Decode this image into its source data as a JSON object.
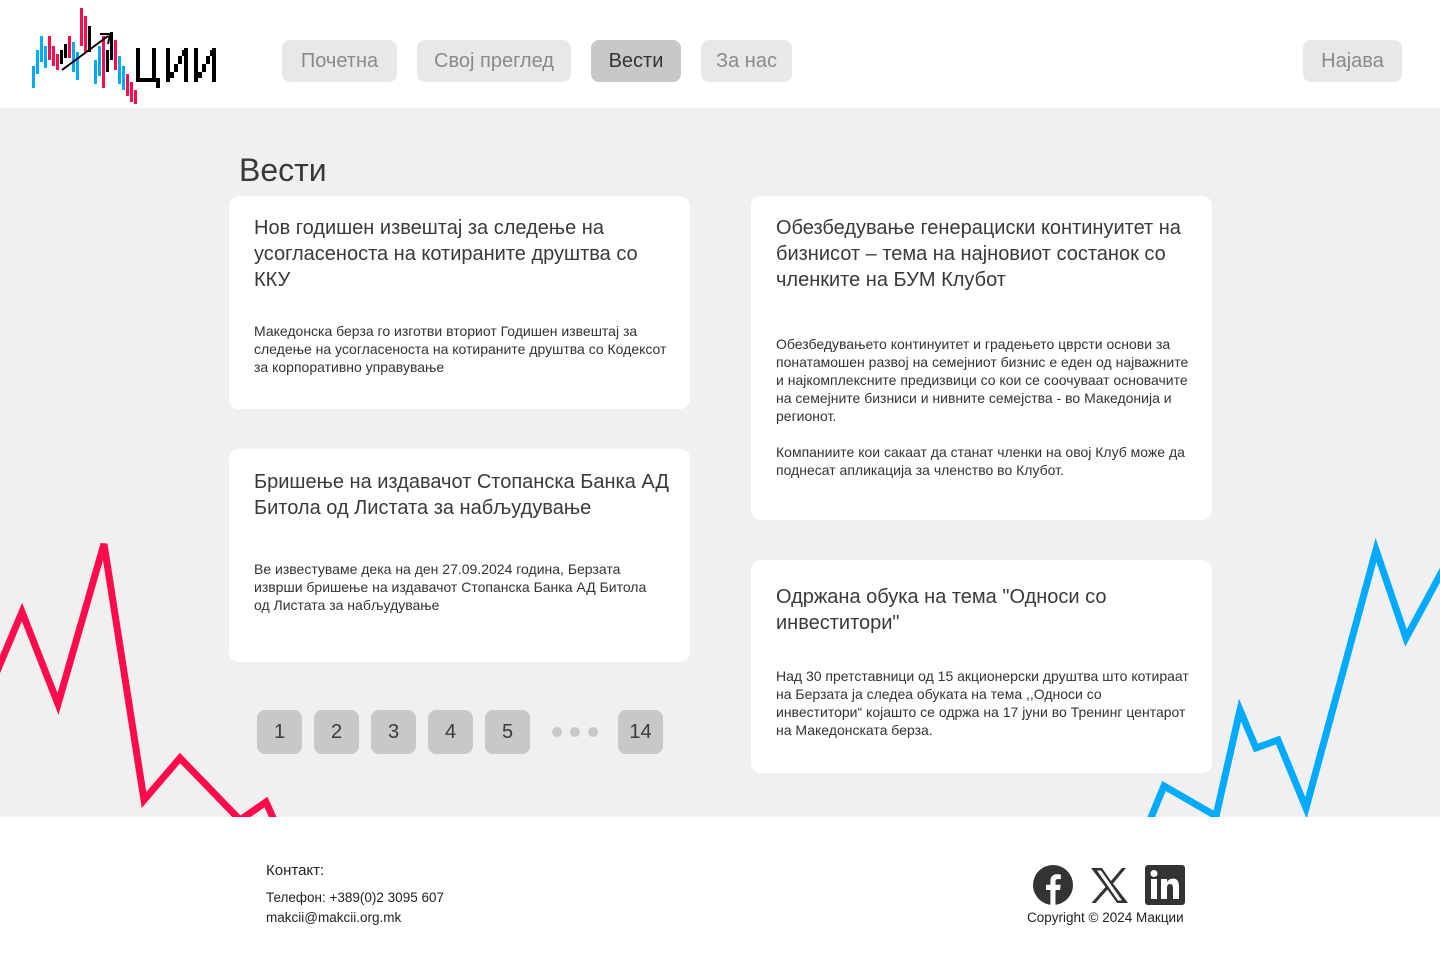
{
  "brand": {
    "logo_text": "МАКЦИИ"
  },
  "nav": {
    "items": [
      "Почетна",
      "Свој преглед",
      "Вести",
      "За нас"
    ],
    "active": "Вести",
    "login": "Најава"
  },
  "main": {
    "title": "Вести",
    "cards": [
      {
        "title": "Нов годишен извештај за следење на усогласеноста на котираните друштва со ККУ",
        "body": "Македонска берза го изготви вториот Годишен извештај за следење на  усогласеноста на котираните друштва со Кодексот за корпоративно  управување"
      },
      {
        "title": "Бришење на издавачот Стопанска Банка АД Битола од Листата за набљудување",
        "body": "Ве известуваме дека на ден 27.09.2024 година, Берзата изврши бришење на  издавачот Стопанска Банка АД Битола од Листата за набљудување"
      },
      {
        "title": "Обезбедување генерациски континуитет на бизнисот – тема на најновиот состанок со членките на БУМ Клубот",
        "body": "Обезбедувањето континуитет и  градењето цврсти основи за  понатамошен  развој на семејниот бизнис е еден од најважните и  најкомплексните  предизвици со кои  се соочуваат основачите на семејните  бизниси и  нивните семејства - во  Македонија и регионот.\n\nКомпаниите кои сакаат да станат членки на овој Клуб може да поднесат апликација за членство во Клубот."
      },
      {
        "title": "Одржана обука на тема \"Односи со инвеститори\"",
        "body": "Над 30 претставници од 15 акционерски друштва што котираат на Берзата ја следеа обуката на тема ,,Односи со инвеститори“ којашто се одржа на 17  јуни во Тренинг центарот на Македонската берза."
      }
    ]
  },
  "pagination": {
    "pages": [
      "1",
      "2",
      "3",
      "4",
      "5"
    ],
    "last": "14"
  },
  "footer": {
    "contact_heading": "Контакт:",
    "phone": "Телефон: +389(0)2 3095 607",
    "email": "makcii@makcii.org.mk",
    "copyright": "Copyright © 2024 Макции",
    "social": [
      "facebook-icon",
      "x-icon",
      "linkedin-icon"
    ]
  },
  "colors": {
    "red": "#ff0a4a",
    "blue": "#00aaff",
    "active_nav": "#c8c8c8",
    "nav": "#e8e8e8",
    "page_bg": "#f0f0f0"
  }
}
